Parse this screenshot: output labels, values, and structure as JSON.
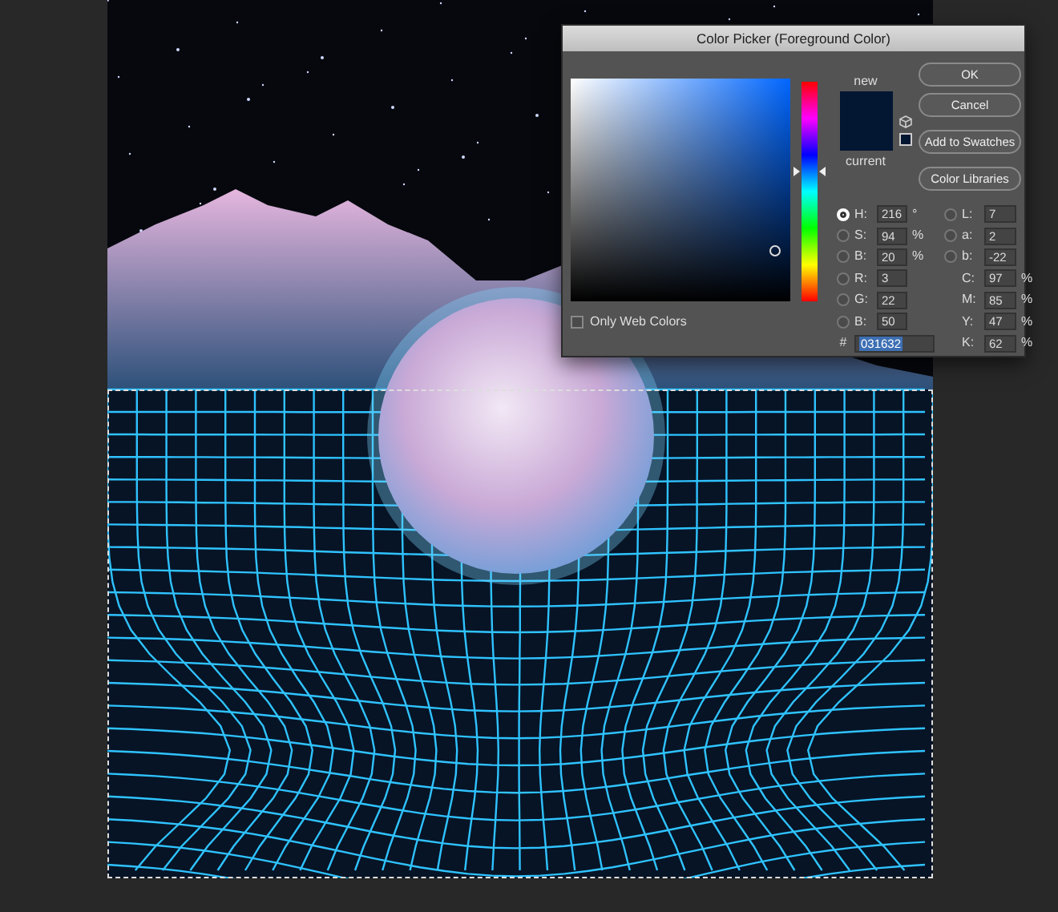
{
  "dialog": {
    "title": "Color Picker (Foreground Color)",
    "swatch": {
      "new_label": "new",
      "current_label": "current"
    },
    "hue_slider": {
      "level": 0.61
    },
    "buttons": [
      "OK",
      "Cancel",
      "Add to Swatches",
      "Color Libraries"
    ],
    "only_web_colors": {
      "label": "Only Web Colors",
      "checked": false
    },
    "left_fields": [
      {
        "kind": "radio",
        "label": "H:",
        "value": "216",
        "unit": "°",
        "selected": true
      },
      {
        "kind": "radio",
        "label": "S:",
        "value": "94",
        "unit": "%",
        "selected": false
      },
      {
        "kind": "radio",
        "label": "B:",
        "value": "20",
        "unit": "%",
        "selected": false
      },
      {
        "kind": "radio",
        "label": "R:",
        "value": "3",
        "selected": false
      },
      {
        "kind": "radio",
        "label": "G:",
        "value": "22",
        "selected": false
      },
      {
        "kind": "radio",
        "label": "B:",
        "value": "50",
        "selected": false
      }
    ],
    "hex": {
      "label": "#",
      "value": "031632",
      "selected": true
    },
    "right_fields": [
      {
        "kind": "radio",
        "label": "L:",
        "value": "7",
        "selected": false
      },
      {
        "kind": "radio",
        "label": "a:",
        "value": "2",
        "selected": false
      },
      {
        "kind": "radio",
        "label": "b:",
        "value": "-22",
        "selected": false
      },
      {
        "kind": "plain",
        "label": "C:",
        "value": "97",
        "unit": "%"
      },
      {
        "kind": "plain",
        "label": "M:",
        "value": "85",
        "unit": "%"
      },
      {
        "kind": "plain",
        "label": "Y:",
        "value": "47",
        "unit": "%"
      },
      {
        "kind": "plain",
        "label": "K:",
        "value": "62",
        "unit": "%"
      }
    ]
  }
}
